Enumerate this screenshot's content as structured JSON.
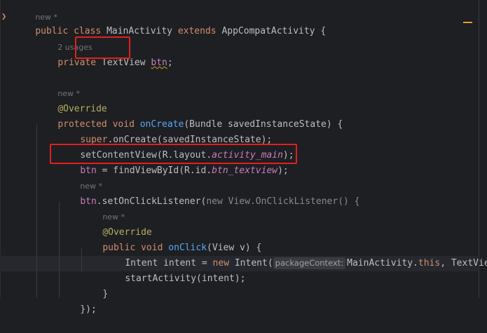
{
  "hints": {
    "new_star": "new *",
    "usages": "2 usages"
  },
  "code": {
    "l1_public": "public",
    "l1_class": "class",
    "l1_name": "MainActivity",
    "l1_extends": "extends",
    "l1_super": "AppCompatActivity {",
    "l2_private": "private",
    "l2_type": "TextView",
    "l2_field": "btn",
    "l2_semi": ";",
    "l3_override": "@Override",
    "l4_protected": "protected",
    "l4_void": "void",
    "l4_method": "onCreate",
    "l4_params": "(Bundle savedInstanceState) {",
    "l5_super": "super",
    "l5_rest": ".onCreate(savedInstanceState);",
    "l6_call": "setContentView(R.layout.",
    "l6_id": "activity_main",
    "l6_end": ");",
    "l7_field": "btn",
    "l7_eq": " = findViewById(R.id.",
    "l7_id": "btn_textview",
    "l7_end": ");",
    "l8_field": "btn",
    "l8_call": ".setOnClickListener(",
    "l8_new": "new",
    "l8_anon": " View.OnClickListener() {",
    "l9_override": "@Override",
    "l10_public": "public",
    "l10_void": "void",
    "l10_method": "onClick",
    "l10_params": "(View v) {",
    "l11_intent": "Intent intent = ",
    "l11_new": "new",
    "l11_call": " Intent(",
    "l11_hint": "packageContext:",
    "l11_ctx": "MainActivity.",
    "l11_this": "this",
    "l11_rest": ", TextVie",
    "l12_call": "startActivity(intent);",
    "l13_brace": "}",
    "l14_close": "});"
  },
  "colors": {
    "background": "#1e1f22",
    "keyword": "#cf8e6d",
    "method": "#56a8f5",
    "annotation": "#b3ae60",
    "field": "#c77dbb",
    "highlight_box": "#e02020"
  }
}
